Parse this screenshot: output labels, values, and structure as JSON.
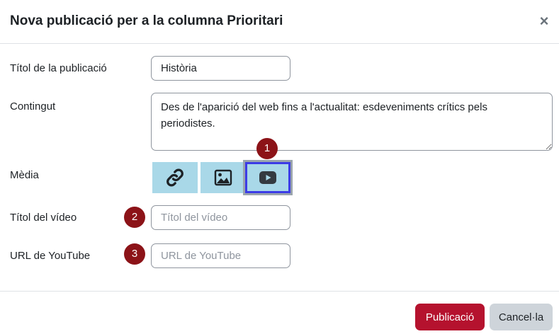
{
  "dialog": {
    "title": "Nova publicació per a la columna Prioritari",
    "close_icon": "×"
  },
  "form": {
    "post_title": {
      "label": "Títol de la publicació",
      "value": "Història"
    },
    "content": {
      "label": "Contingut",
      "value": "Des de l'aparició del web fins a l'actualitat: esdeveniments crítics pels periodistes."
    },
    "media": {
      "label": "Mèdia",
      "options": [
        {
          "icon": "link-icon",
          "selected": false
        },
        {
          "icon": "image-icon",
          "selected": false
        },
        {
          "icon": "youtube-play-icon",
          "selected": true
        }
      ]
    },
    "video_title": {
      "label": "Títol del vídeo",
      "value": "",
      "placeholder": "Títol del vídeo"
    },
    "youtube_url": {
      "label": "URL de YouTube",
      "value": "",
      "placeholder": "URL de YouTube"
    }
  },
  "annotations": {
    "badge1": "1",
    "badge2": "2",
    "badge3": "3"
  },
  "footer": {
    "submit_label": "Publicació",
    "cancel_label": "Cancel·la"
  },
  "colors": {
    "primary": "#b5122e",
    "media_button_bg": "#a9d8e8",
    "selected_border": "#3c3ce6",
    "badge": "#8c1318",
    "secondary_button": "#ced4da"
  }
}
